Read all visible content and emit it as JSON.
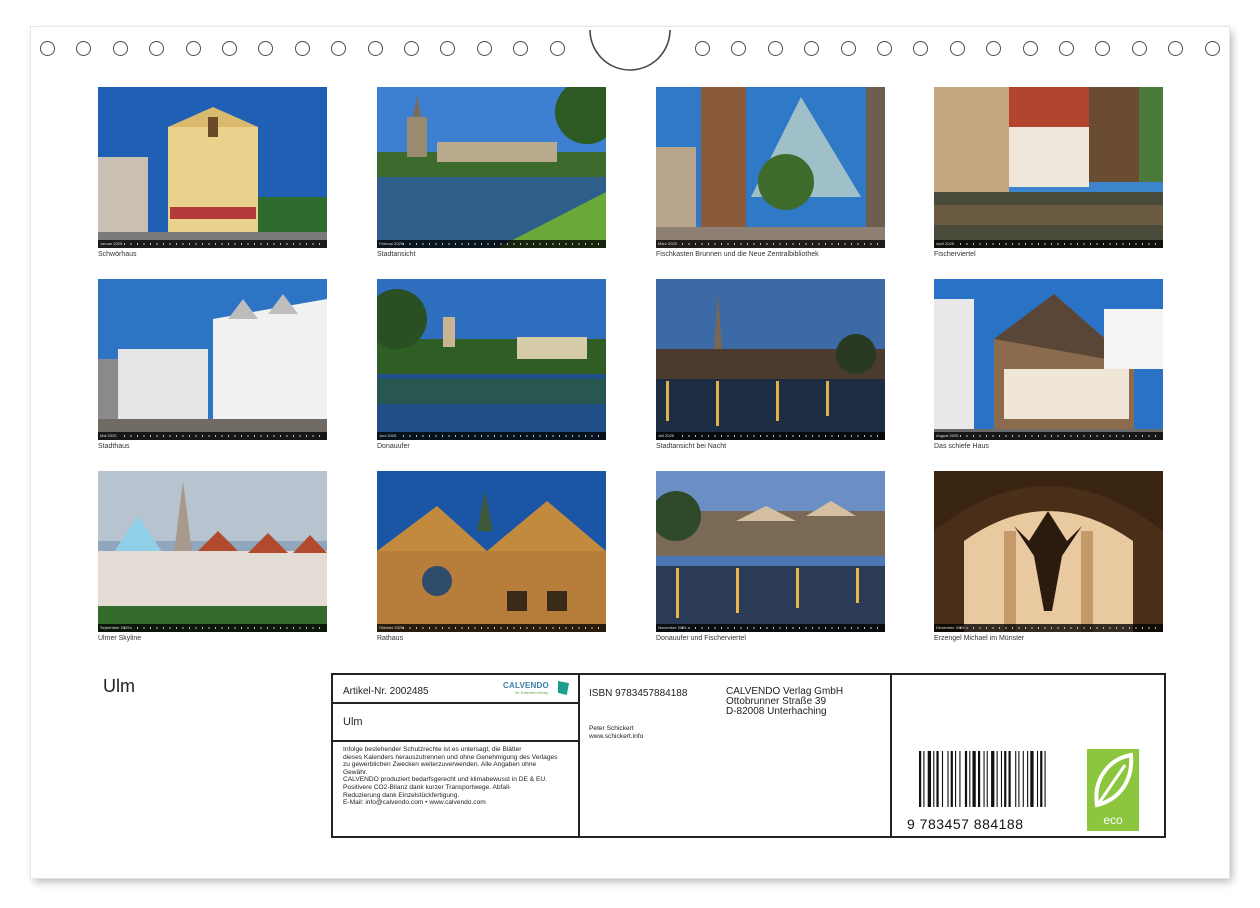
{
  "title": "Ulm",
  "months": [
    {
      "label": "Januar 2025",
      "caption": "Schwörhaus",
      "scene": "town-hall",
      "sky": "#1f5fb4"
    },
    {
      "label": "Februar 2025",
      "caption": "Stadtansicht",
      "scene": "river",
      "sky": "#3d7fd0"
    },
    {
      "label": "März 2025",
      "caption": "Fischkasten Brunnen und die Neue Zentralbibliothek",
      "scene": "pyramid",
      "sky": "#2f79c7"
    },
    {
      "label": "April 2025",
      "caption": "Fischerviertel",
      "scene": "canal",
      "sky": "#3c84cc"
    },
    {
      "label": "Mai 2025",
      "caption": "Stadthaus",
      "scene": "modern",
      "sky": "#2d74c5"
    },
    {
      "label": "Juni 2025",
      "caption": "Donauufer",
      "scene": "reflection",
      "sky": "#2e6fc0"
    },
    {
      "label": "Juli 2025",
      "caption": "Stadtansicht bei Nacht",
      "scene": "night",
      "sky": "#355f96"
    },
    {
      "label": "August 2025",
      "caption": "Das schiefe Haus",
      "scene": "leaning",
      "sky": "#2a72c6"
    },
    {
      "label": "September 2025",
      "caption": "Ulmer Skyline",
      "scene": "skyline",
      "sky": "#8fa6bd"
    },
    {
      "label": "Oktober 2025",
      "caption": "Rathaus",
      "scene": "rathaus",
      "sky": "#1b55a6"
    },
    {
      "label": "November 2025",
      "caption": "Donauufer und Fischerviertel",
      "scene": "dusk",
      "sky": "#4a78b4"
    },
    {
      "label": "Dezember 2025",
      "caption": "Erzengel Michael im Münster",
      "scene": "minster",
      "sky": "#3a2412"
    }
  ],
  "info": {
    "article_no": "Artikel-Nr. 2002485",
    "logo_brand": "CALVENDO",
    "logo_tag": "Ihr Kalenderverlag",
    "subtitle": "Ulm",
    "legal_lines": "Infolge bestehender Schutzrechte ist es untersagt, die Blätter\ndieses Kalenders herauszutrennen und ohne Genehmigung des Verlages\nzu gewerblichen Zwecken weiterzuverwenden. Alle Angaben ohne\nGewähr.\nCALVENDO produziert bedarfsgerecht und klimabewusst in DE & EU.\nPositivere CO2-Bilanz dank kurzer Transportwege. Abfall-\nReduzierung dank Einzelstückfertigung.\nE-Mail: info@calvendo.com • www.calvendo.com",
    "isbn": "ISBN 9783457884188",
    "publisher_lines": "CALVENDO Verlag GmbH\nOttobrunner Straße 39\nD-82008 Unterhaching",
    "photographer_lines": "Peter Schickert\nwww.schickert.info",
    "barcode_number": "9  783457  884188",
    "eco_label": "eco"
  },
  "colors": {
    "border": "#222222",
    "eco_green": "#8cc63f",
    "calvendo_blue": "#3b7fa6"
  }
}
